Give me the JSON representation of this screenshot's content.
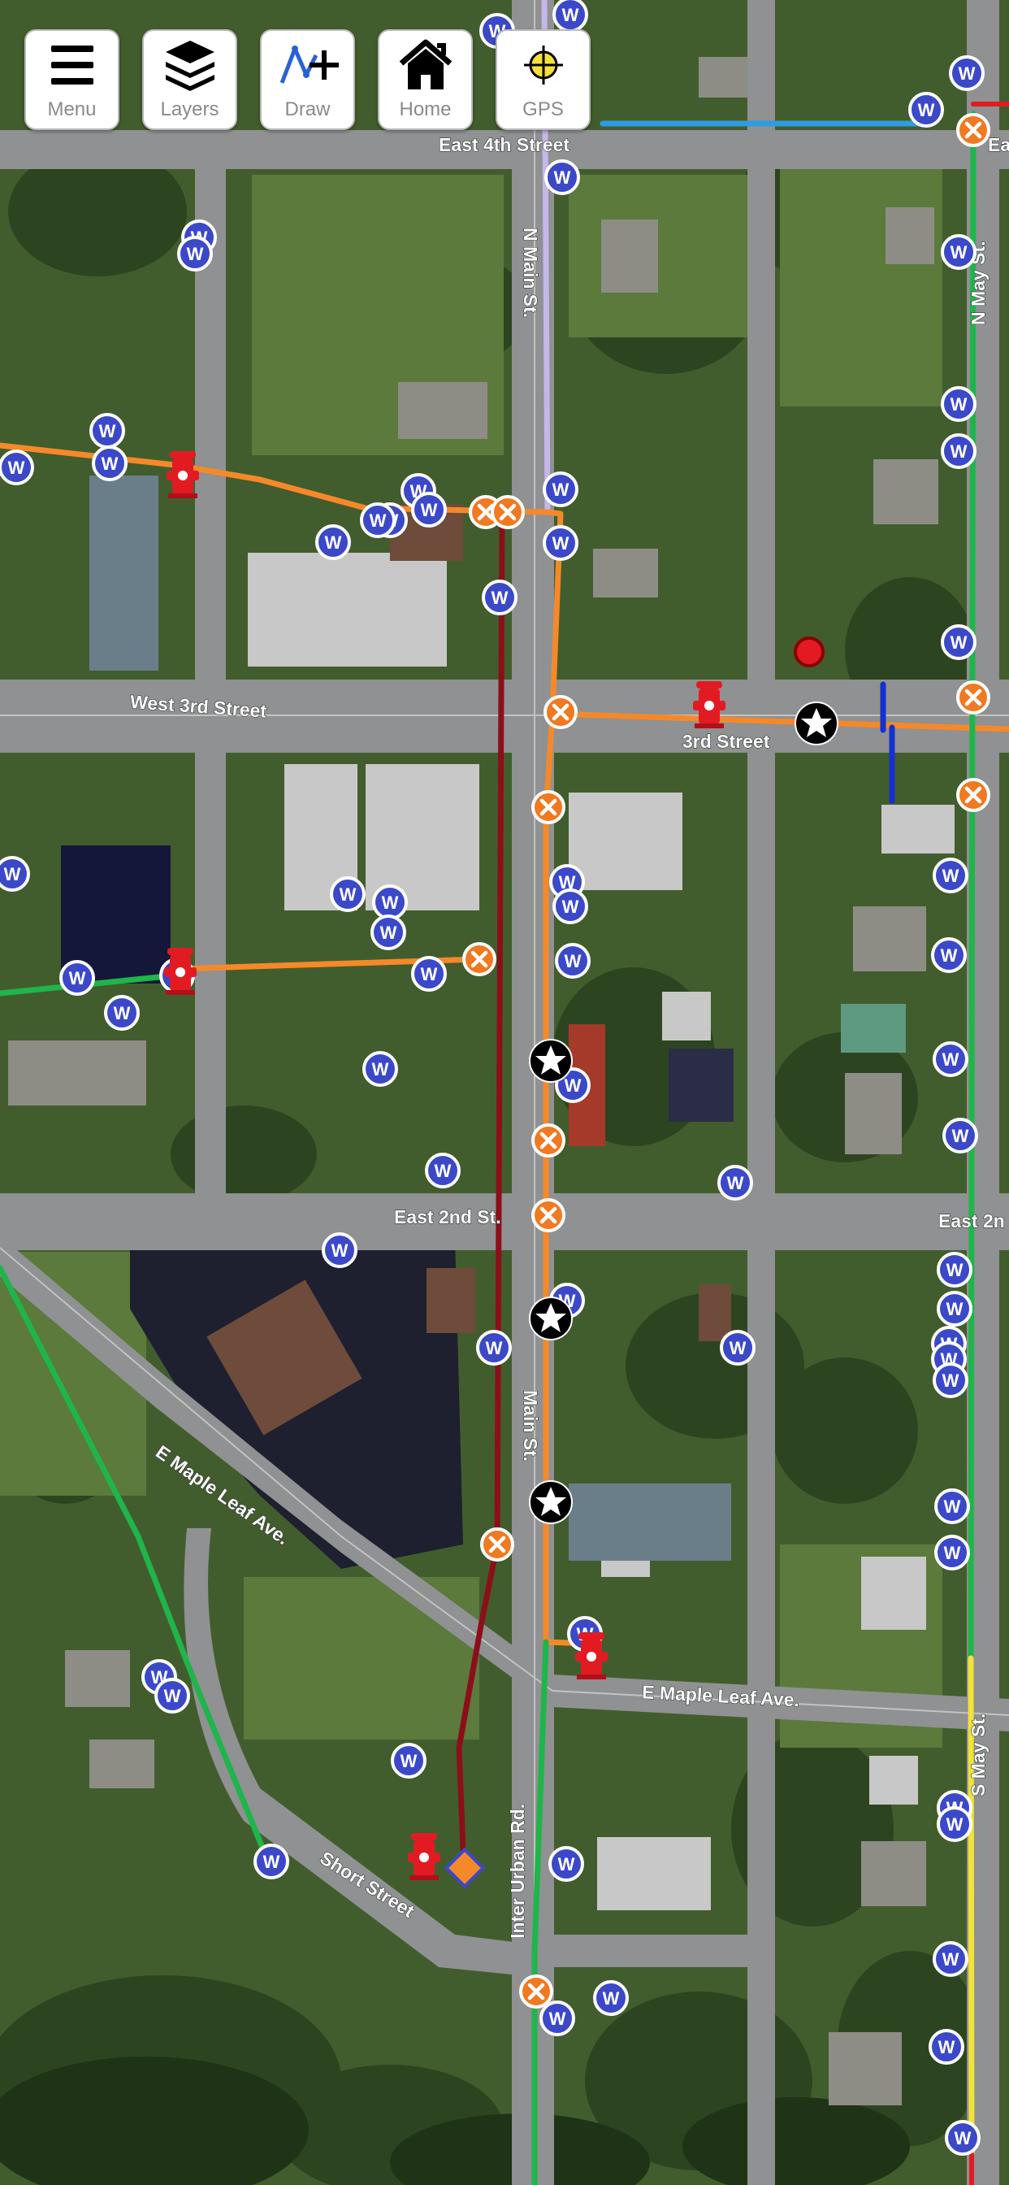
{
  "toolbar": {
    "menu_label": "Menu",
    "layers_label": "Layers",
    "draw_label": "Draw",
    "home_label": "Home",
    "gps_label": "GPS"
  },
  "streets": {
    "east_4th": "East 4th Street",
    "west_3rd": "West 3rd Street",
    "third": "3rd Street",
    "east_2nd": "East 2nd St.",
    "east_2nd_right": "East 2n",
    "n_main": "N Main St.",
    "main": "Main St.",
    "n_may": "N May St.",
    "s_may": "S May St.",
    "e_maple_leaf_left": "E Maple Leaf Ave.",
    "e_maple_leaf_right": "E Maple Leaf Ave.",
    "inter_urban": "Inter Urban Rd.",
    "short_street": "Short Street",
    "ea_top": "Ea"
  },
  "markers": {
    "well_letter": "W"
  },
  "colors": {
    "water_orange": "#f5892a",
    "water_green": "#1fb54a",
    "water_darkred": "#8b0f1a",
    "water_lightblue": "#2f9be0",
    "water_yellow": "#f2e23a",
    "water_lavender": "#c5b8e8",
    "water_blue": "#1530d0",
    "well_blue": "#3b49c8",
    "hydrant_red": "#e21b22",
    "valve_orange": "#f07a22"
  }
}
